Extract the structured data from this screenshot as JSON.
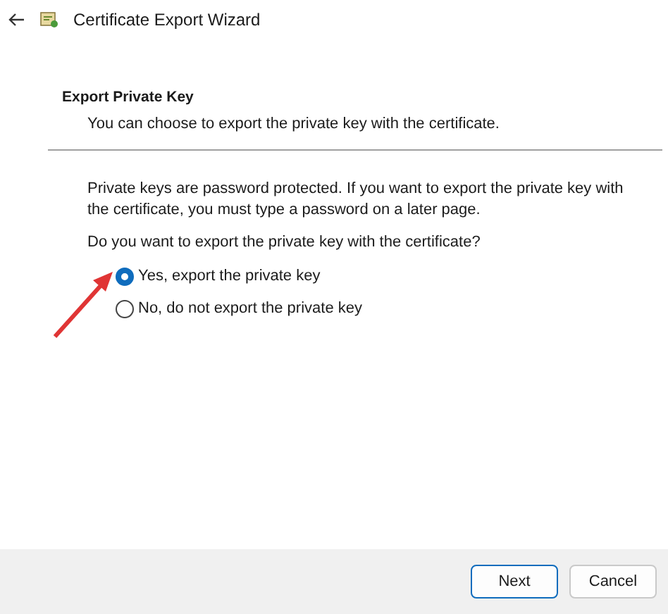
{
  "window": {
    "title": "Certificate Export Wizard"
  },
  "header": {
    "title": "Export Private Key",
    "subtitle": "You can choose to export the private key with the certificate."
  },
  "body": {
    "description": "Private keys are password protected. If you want to export the private key with the certificate, you must type a password on a later page.",
    "question": "Do you want to export the private key with the certificate?"
  },
  "options": [
    {
      "label": "Yes, export the private key",
      "selected": true
    },
    {
      "label": "No, do not export the private key",
      "selected": false
    }
  ],
  "buttons": [
    {
      "label": "Next",
      "kind": "primary"
    },
    {
      "label": "Cancel",
      "kind": "secondary"
    }
  ]
}
